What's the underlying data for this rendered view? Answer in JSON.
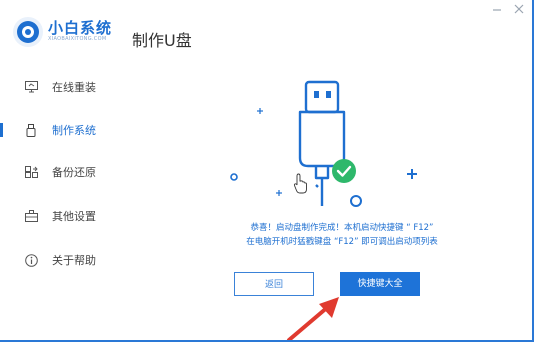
{
  "header": {
    "brand_name": "小白系统",
    "brand_sub": "XIAOBAIXITONG.COM",
    "page_title": "制作U盘",
    "icons": {
      "logo": "xiaobai-logo",
      "minimize": "minimize-icon",
      "close": "close-icon"
    }
  },
  "sidebar": {
    "items": [
      {
        "label": "在线重装",
        "icon": "monitor-icon",
        "active": false
      },
      {
        "label": "制作系统",
        "icon": "usb-icon",
        "active": true
      },
      {
        "label": "备份还原",
        "icon": "backup-icon",
        "active": false
      },
      {
        "label": "其他设置",
        "icon": "briefcase-icon",
        "active": false
      },
      {
        "label": "关于帮助",
        "icon": "info-icon",
        "active": false
      }
    ]
  },
  "main": {
    "message_line1": "恭喜！启动盘制作完成！本机启动快捷键 “ F12”",
    "message_line2": "在电脑开机时猛戳键盘 “F12” 即可调出启动项列表",
    "back_label": "返回",
    "hotkeys_label": "快捷键大全"
  },
  "colors": {
    "accent": "#1e6fd0",
    "success": "#2eb86b",
    "annotation_arrow": "#e03a2f"
  }
}
